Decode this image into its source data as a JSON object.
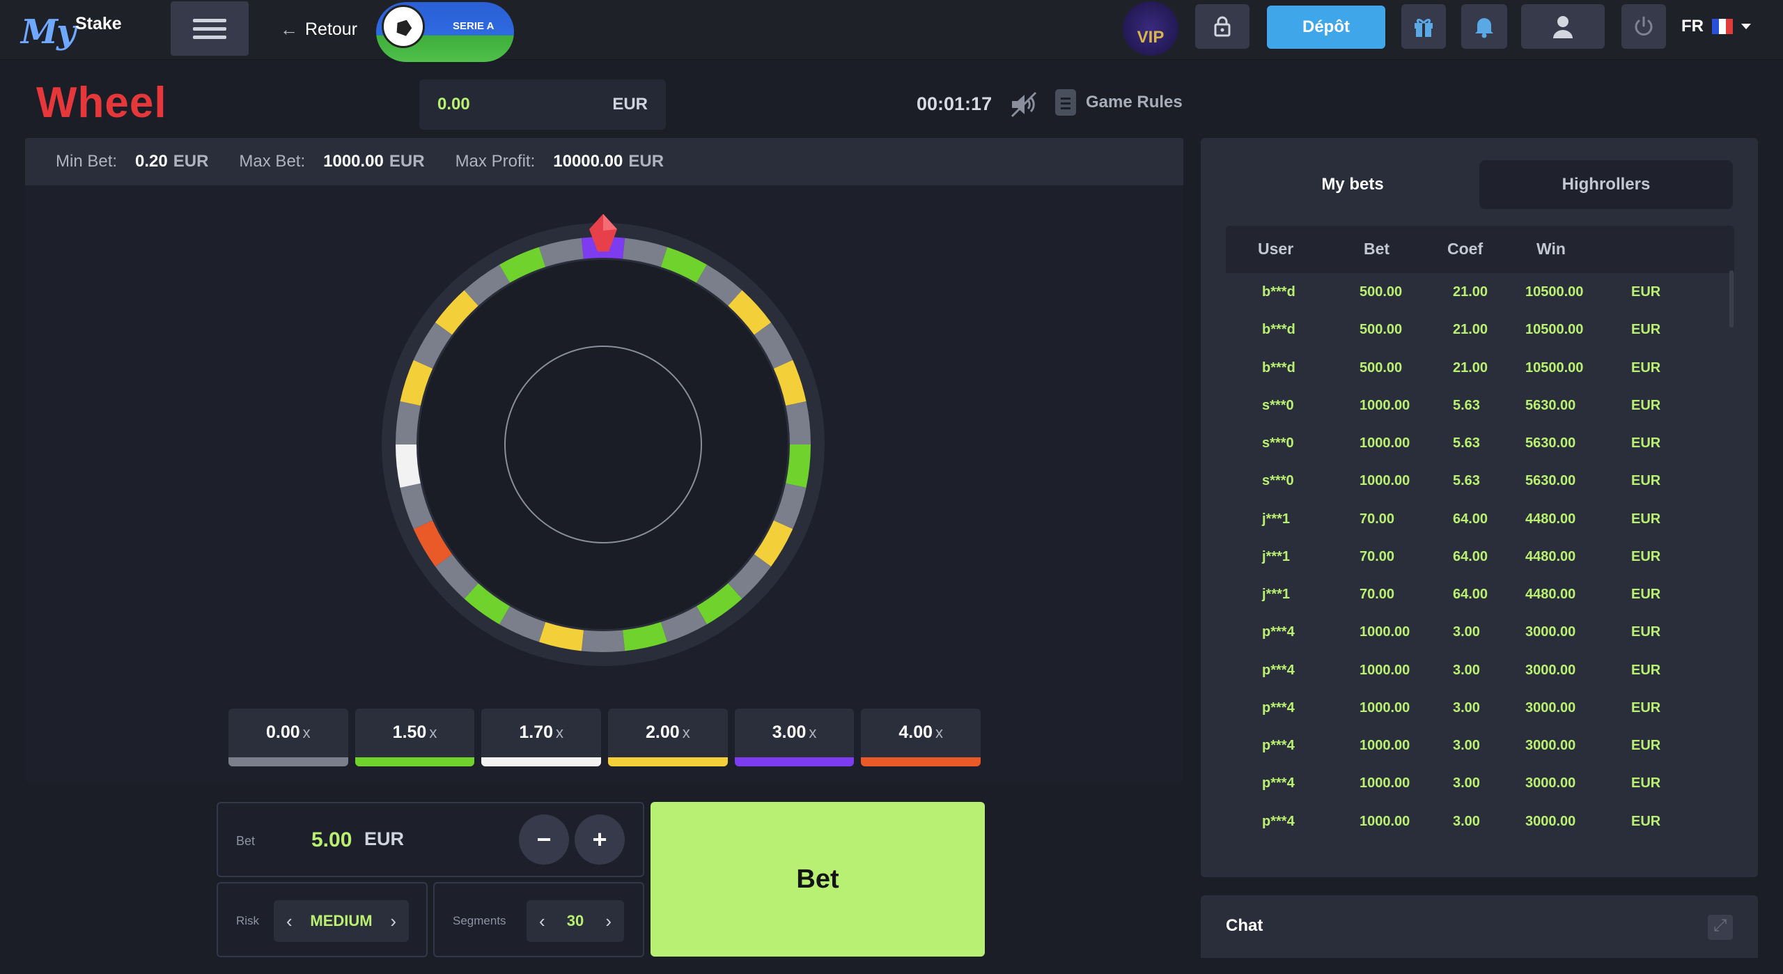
{
  "header": {
    "logo_my": "My",
    "logo_stake": "Stake",
    "back_label": "Retour",
    "promo_label": "SERIE A",
    "vip_label": "VIP",
    "deposit_label": "Dépôt",
    "language": "FR"
  },
  "game": {
    "title": "Wheel",
    "balance_value": "0.00",
    "balance_currency": "EUR",
    "timer": "00:01:17",
    "rules_label": "Game Rules"
  },
  "limits": {
    "min_label": "Min Bet:",
    "min_value": "0.20",
    "min_currency": "EUR",
    "max_label": "Max Bet:",
    "max_value": "1000.00",
    "max_currency": "EUR",
    "profit_label": "Max Profit:",
    "profit_value": "10000.00",
    "profit_currency": "EUR"
  },
  "wheel": {
    "segment_colors": [
      "grey",
      "green",
      "grey",
      "yellow",
      "grey",
      "yellow",
      "grey",
      "green",
      "grey",
      "yellow",
      "grey",
      "green",
      "grey",
      "green",
      "grey",
      "yellow",
      "grey",
      "green",
      "grey",
      "orange",
      "grey",
      "white",
      "grey",
      "yellow",
      "grey",
      "yellow",
      "grey",
      "green",
      "grey",
      "purple"
    ],
    "palette": {
      "grey": "#7b7f8c",
      "green": "#6fd22d",
      "yellow": "#f3cf3a",
      "white": "#f2f2f2",
      "orange": "#ea5a29",
      "purple": "#7d3cf0"
    },
    "pointer_color": "#e8404b"
  },
  "multipliers": [
    {
      "value": "0.00",
      "suffix": "x",
      "color": "#7b7f8c"
    },
    {
      "value": "1.50",
      "suffix": "x",
      "color": "#6fd22d"
    },
    {
      "value": "1.70",
      "suffix": "x",
      "color": "#f2f2f2"
    },
    {
      "value": "2.00",
      "suffix": "x",
      "color": "#f3cf3a"
    },
    {
      "value": "3.00",
      "suffix": "x",
      "color": "#7d3cf0"
    },
    {
      "value": "4.00",
      "suffix": "x",
      "color": "#ea5a29"
    }
  ],
  "controls": {
    "bet_label": "Bet",
    "bet_value": "5.00",
    "bet_currency": "EUR",
    "minus": "−",
    "plus": "+",
    "risk_label": "Risk",
    "risk_value": "MEDIUM",
    "segments_label": "Segments",
    "segments_value": "30",
    "bet_button": "Bet"
  },
  "bets_panel": {
    "tabs": [
      "My bets",
      "Highrollers"
    ],
    "columns": [
      "User",
      "Bet",
      "Coef",
      "Win"
    ],
    "rows": [
      {
        "user": "b***d",
        "bet": "500.00",
        "coef": "21.00",
        "win": "10500.00",
        "cur": "EUR"
      },
      {
        "user": "b***d",
        "bet": "500.00",
        "coef": "21.00",
        "win": "10500.00",
        "cur": "EUR"
      },
      {
        "user": "b***d",
        "bet": "500.00",
        "coef": "21.00",
        "win": "10500.00",
        "cur": "EUR"
      },
      {
        "user": "s***0",
        "bet": "1000.00",
        "coef": "5.63",
        "win": "5630.00",
        "cur": "EUR"
      },
      {
        "user": "s***0",
        "bet": "1000.00",
        "coef": "5.63",
        "win": "5630.00",
        "cur": "EUR"
      },
      {
        "user": "s***0",
        "bet": "1000.00",
        "coef": "5.63",
        "win": "5630.00",
        "cur": "EUR"
      },
      {
        "user": "j***1",
        "bet": "70.00",
        "coef": "64.00",
        "win": "4480.00",
        "cur": "EUR"
      },
      {
        "user": "j***1",
        "bet": "70.00",
        "coef": "64.00",
        "win": "4480.00",
        "cur": "EUR"
      },
      {
        "user": "j***1",
        "bet": "70.00",
        "coef": "64.00",
        "win": "4480.00",
        "cur": "EUR"
      },
      {
        "user": "p***4",
        "bet": "1000.00",
        "coef": "3.00",
        "win": "3000.00",
        "cur": "EUR"
      },
      {
        "user": "p***4",
        "bet": "1000.00",
        "coef": "3.00",
        "win": "3000.00",
        "cur": "EUR"
      },
      {
        "user": "p***4",
        "bet": "1000.00",
        "coef": "3.00",
        "win": "3000.00",
        "cur": "EUR"
      },
      {
        "user": "p***4",
        "bet": "1000.00",
        "coef": "3.00",
        "win": "3000.00",
        "cur": "EUR"
      },
      {
        "user": "p***4",
        "bet": "1000.00",
        "coef": "3.00",
        "win": "3000.00",
        "cur": "EUR"
      },
      {
        "user": "p***4",
        "bet": "1000.00",
        "coef": "3.00",
        "win": "3000.00",
        "cur": "EUR"
      }
    ]
  },
  "chat": {
    "label": "Chat"
  }
}
